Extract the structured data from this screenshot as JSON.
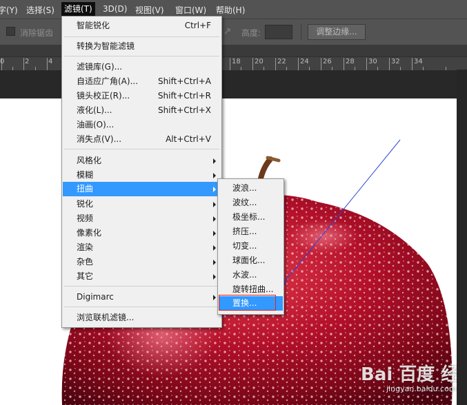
{
  "menubar": {
    "items": [
      {
        "label": "字(Y)"
      },
      {
        "label": "选择(S)"
      },
      {
        "label": "滤镜(T)"
      },
      {
        "label": "3D(D)"
      },
      {
        "label": "视图(V)"
      },
      {
        "label": "窗口(W)"
      },
      {
        "label": "帮助(H)"
      }
    ]
  },
  "options": {
    "antialias_label": "消除锯齿",
    "height_label": "高度:",
    "refine_button": "调整边缘..."
  },
  "ruler": {
    "labels": [
      "0",
      "2",
      "4",
      "18",
      "20",
      "22",
      "24",
      "26",
      "28",
      "30",
      "32",
      "34"
    ]
  },
  "filter_menu": {
    "items": [
      {
        "label": "智能锐化",
        "shortcut": "Ctrl+F"
      },
      {
        "label": "转换为智能滤镜",
        "shortcut": ""
      },
      {
        "label": "滤镜库(G)...",
        "shortcut": ""
      },
      {
        "label": "自适应广角(A)...",
        "shortcut": "Shift+Ctrl+A"
      },
      {
        "label": "镜头校正(R)...",
        "shortcut": "Shift+Ctrl+R"
      },
      {
        "label": "液化(L)...",
        "shortcut": "Shift+Ctrl+X"
      },
      {
        "label": "油画(O)...",
        "shortcut": ""
      },
      {
        "label": "消失点(V)...",
        "shortcut": "Alt+Ctrl+V"
      },
      {
        "label": "风格化",
        "shortcut": ""
      },
      {
        "label": "模糊",
        "shortcut": ""
      },
      {
        "label": "扭曲",
        "shortcut": ""
      },
      {
        "label": "锐化",
        "shortcut": ""
      },
      {
        "label": "视频",
        "shortcut": ""
      },
      {
        "label": "像素化",
        "shortcut": ""
      },
      {
        "label": "渲染",
        "shortcut": ""
      },
      {
        "label": "杂色",
        "shortcut": ""
      },
      {
        "label": "其它",
        "shortcut": ""
      },
      {
        "label": "Digimarc",
        "shortcut": ""
      },
      {
        "label": "浏览联机滤镜...",
        "shortcut": ""
      }
    ]
  },
  "distort_submenu": {
    "items": [
      {
        "label": "波浪..."
      },
      {
        "label": "波纹..."
      },
      {
        "label": "极坐标..."
      },
      {
        "label": "挤压..."
      },
      {
        "label": "切变..."
      },
      {
        "label": "球面化..."
      },
      {
        "label": "水波..."
      },
      {
        "label": "旋转扭曲..."
      },
      {
        "label": "置换..."
      }
    ]
  },
  "watermark": {
    "logo": "Bai 百度 经验",
    "url": "jingyan.baidu.com"
  },
  "colors": {
    "highlight": "#3399ff",
    "annotation_box": "#e02020",
    "annotation_arrow": "#2a45d8"
  }
}
